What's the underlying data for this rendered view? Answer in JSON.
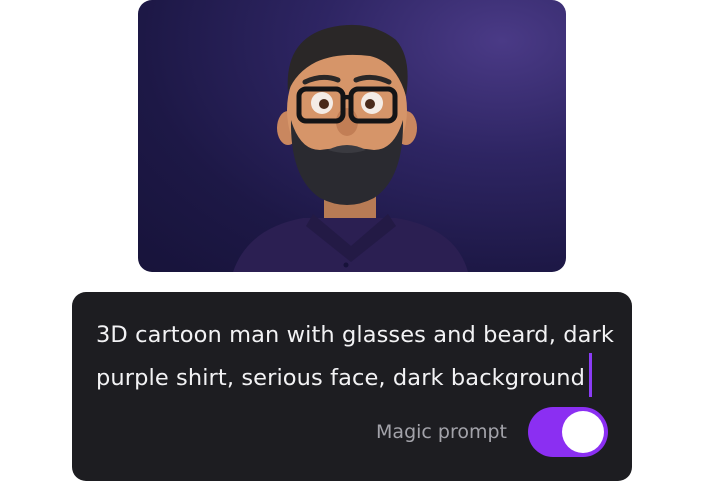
{
  "prompt": {
    "line1": "3D cartoon man with glasses and beard, dark",
    "line2": "purple shirt, serious face, dark background",
    "accent_color": "#8b3cf6"
  },
  "magic_prompt": {
    "label": "Magic prompt",
    "enabled": true
  },
  "colors": {
    "card_background": "#1d1d21",
    "toggle_on": "#8b2ff2",
    "image_background": "#2e2563"
  }
}
